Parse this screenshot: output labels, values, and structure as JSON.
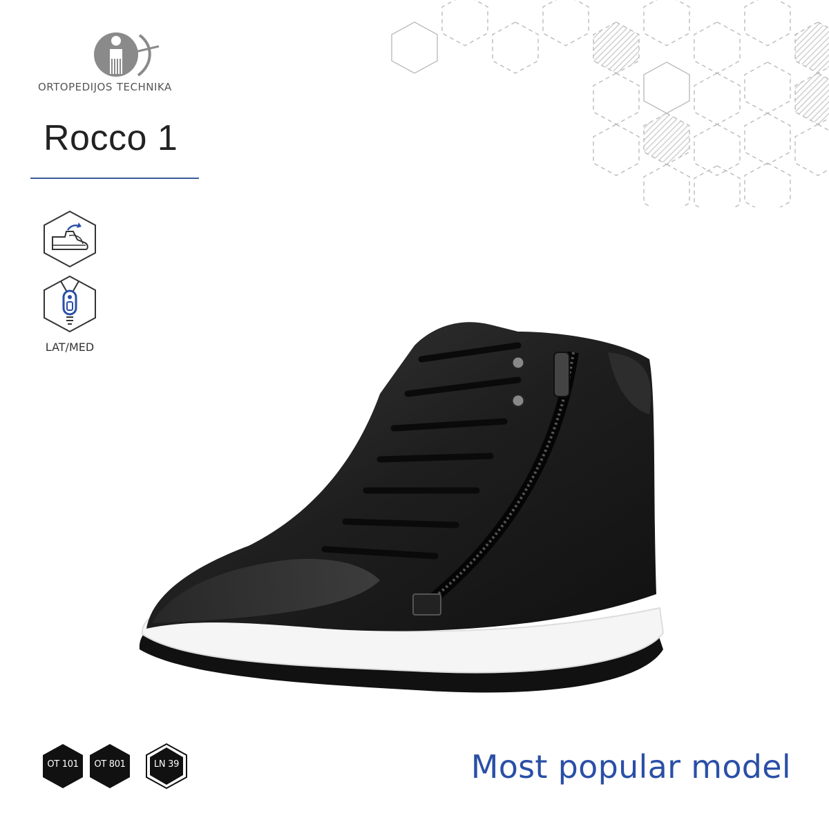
{
  "brand": {
    "word_1": "ORTOPEDIJOS",
    "word_2": "TECHNIKA"
  },
  "product": {
    "title": "Rocco 1"
  },
  "features": [
    {
      "icon": "orthopedic-boot-icon",
      "label": ""
    },
    {
      "icon": "zipper-icon",
      "label": "LAT/MED"
    }
  ],
  "badges": [
    {
      "label": "OT 101",
      "style": "filled"
    },
    {
      "label": "OT 801",
      "style": "filled"
    },
    {
      "label": "LN 39",
      "style": "outlined"
    }
  ],
  "tagline": "Most popular model",
  "colors": {
    "accent_blue": "#2a4fa6",
    "rule_blue": "#3a5a9a",
    "badge_black": "#111111",
    "text_dark": "#222222"
  }
}
